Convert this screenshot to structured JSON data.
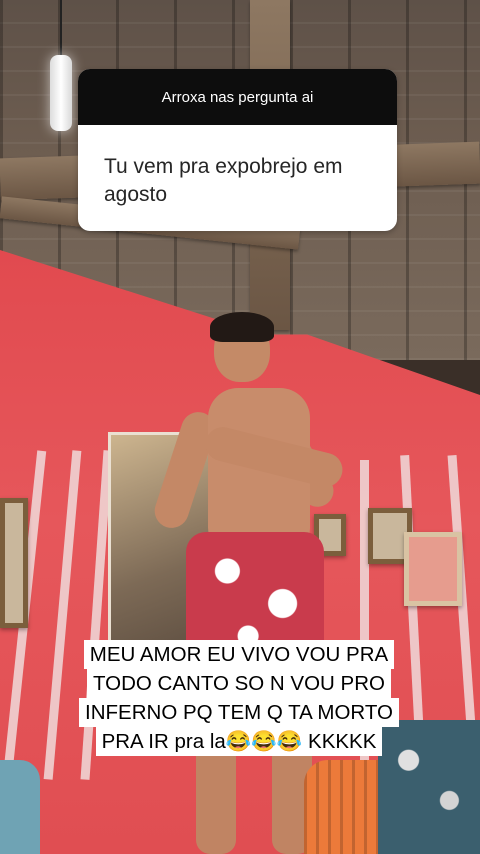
{
  "question_sticker": {
    "header": "Arroxa nas pergunta ai",
    "question": "Tu vem pra expobrejo em agosto"
  },
  "caption": {
    "lines": [
      "MEU AMOR EU VIVO VOU PRA",
      "TODO CANTO SO N VOU PRO",
      "INFERNO PQ TEM Q TA MORTO",
      "PRA IR pra la😂😂😂 KKKKK"
    ]
  },
  "colors": {
    "wall": "#e14a4f",
    "sticker_header": "#0d0d0d",
    "sticker_body": "#ffffff"
  }
}
